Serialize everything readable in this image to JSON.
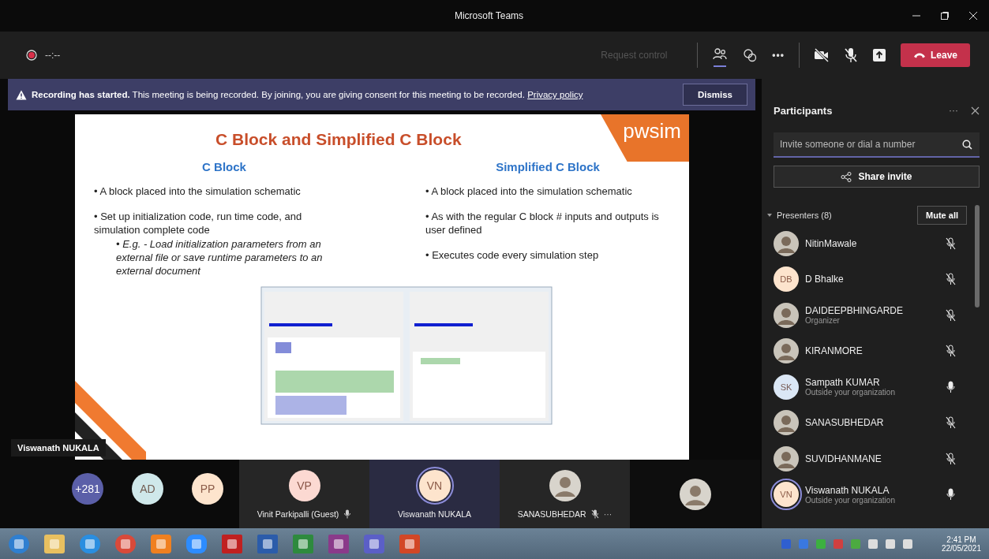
{
  "window": {
    "title": "Microsoft Teams"
  },
  "toolbar": {
    "timer": "--:--",
    "request_control": "Request control",
    "more": "•••",
    "leave": "Leave"
  },
  "banner": {
    "text": "**Recording has started.** This meeting is being recorded. By joining, you are giving consent for this meeting to be recorded.",
    "link": "Privacy policy",
    "dismiss": "Dismiss"
  },
  "slide": {
    "title": "C Block and Simplified C Block",
    "logo": "pwsim",
    "columns": [
      {
        "heading": "C Block",
        "bullets": [
          {
            "kind": "main",
            "text": "• A block placed into the simulation schematic"
          },
          {
            "kind": "main",
            "text": "• Set up initialization code, run time code, and simulation complete code"
          },
          {
            "kind": "sub",
            "text": "• E.g. - Load initialization parameters from an external file or save runtime parameters to an external document"
          }
        ]
      },
      {
        "heading": "Simplified C Block",
        "bullets": [
          {
            "kind": "main",
            "text": "• A block placed into the simulation schematic"
          },
          {
            "kind": "main",
            "text": "• As with the regular C block # inputs and outputs is user defined"
          },
          {
            "kind": "main",
            "text": "• Executes code every simulation step"
          }
        ]
      }
    ]
  },
  "presenter_label": "Viswanath NUKALA",
  "stage": {
    "avatars": [
      {
        "initials": "+281",
        "color": "#5b5fa8"
      },
      {
        "initials": "AD",
        "color": "#cfe8ea"
      },
      {
        "initials": "PP",
        "color": "#fde4cd"
      }
    ],
    "tiles": [
      {
        "kind": "initials",
        "initials": "VP",
        "color": "#fcd9d2",
        "name": "Vinit Parkipalli (Guest)",
        "muted": false,
        "speaking": false,
        "selected": false
      },
      {
        "kind": "initials",
        "initials": "VN",
        "color": "#fde4cd",
        "name": "Viswanath NUKALA",
        "speaking": true,
        "selected": true
      },
      {
        "kind": "photo",
        "name": "SANASUBHEDAR",
        "muted": true,
        "more": "···",
        "speaking": false,
        "selected": false
      },
      {
        "kind": "photo",
        "speaking": false,
        "selected": false
      }
    ]
  },
  "participants": {
    "title": "Participants",
    "more": "···",
    "search": {
      "placeholder": "Invite someone or dial a number"
    },
    "share": "Share invite",
    "section": "Presenters (8)",
    "mute_all": "Mute all",
    "people": [
      {
        "kind": "photo",
        "name": "NitinMawale",
        "muted": true,
        "speaking": false
      },
      {
        "kind": "initials",
        "name": "D Bhalke",
        "initials": "DB",
        "color": "#fde4cd",
        "muted": true,
        "speaking": false
      },
      {
        "kind": "photo",
        "name": "DAIDEEPBHINGARDE",
        "note": "Organizer",
        "muted": true,
        "speaking": false
      },
      {
        "kind": "photo",
        "name": "KIRANMORE",
        "muted": true,
        "speaking": false
      },
      {
        "kind": "initials",
        "name": "Sampath KUMAR",
        "note": "Outside your organization",
        "initials": "SK",
        "color": "#dbe7f5",
        "muted": false,
        "speaking": false
      },
      {
        "kind": "photo",
        "name": "SANASUBHEDAR",
        "muted": true,
        "speaking": false
      },
      {
        "kind": "photo",
        "name": "SUVIDHANMANE",
        "muted": true,
        "speaking": false
      },
      {
        "kind": "initials",
        "name": "Viswanath NUKALA",
        "note": "Outside your organization",
        "initials": "VN",
        "color": "#fde4cd",
        "muted": false,
        "speaking": true
      }
    ]
  },
  "taskbar": {
    "time": "2:41 PM",
    "date": "22/05/2021"
  }
}
